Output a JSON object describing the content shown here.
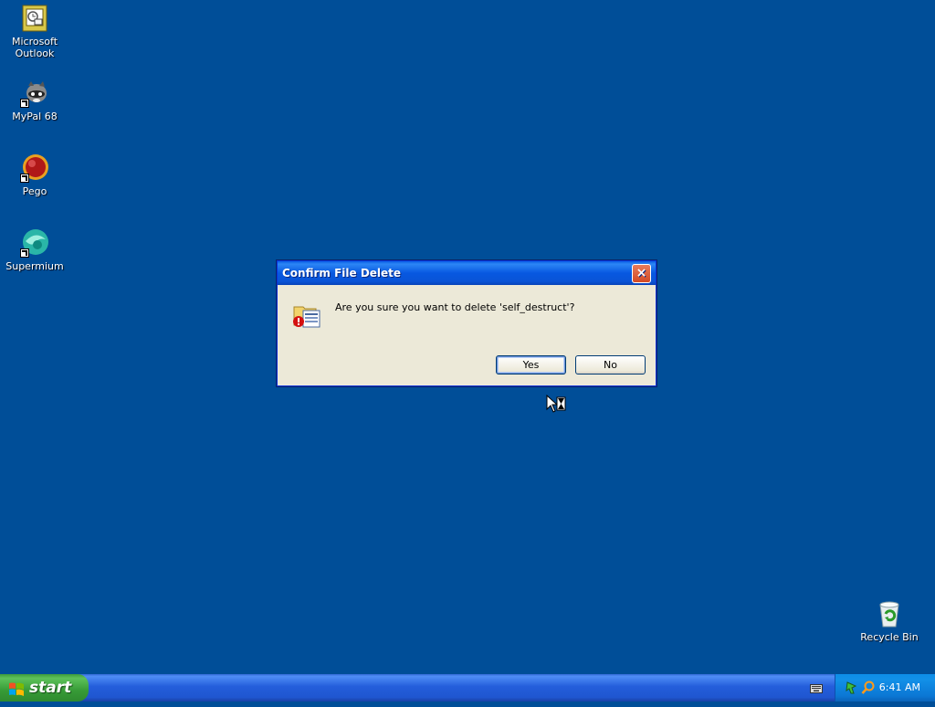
{
  "desktop": {
    "icons": [
      {
        "label": "Microsoft Outlook",
        "icon": "outlook-icon"
      },
      {
        "label": "MyPal 68",
        "icon": "mypal-raccoon-icon"
      },
      {
        "label": "Pego",
        "icon": "pego-red-ball-icon"
      },
      {
        "label": "Supermium",
        "icon": "supermium-icon"
      },
      {
        "label": "Recycle Bin",
        "icon": "recycle-bin-icon"
      }
    ]
  },
  "dialog": {
    "title": "Confirm File Delete",
    "close_label": "×",
    "message": "Are you sure you want to delete 'self_destruct'?",
    "yes_label": "Yes",
    "no_label": "No",
    "icon": "delete-file-warning-icon"
  },
  "taskbar": {
    "start_label": "start",
    "clock": "6:41 AM",
    "tray_icons": [
      "network-icon",
      "search-icon"
    ]
  },
  "colors": {
    "desktop": "#004e98",
    "titlebar": "#0758e1",
    "start": "#379b37",
    "close": "#d44a24"
  }
}
